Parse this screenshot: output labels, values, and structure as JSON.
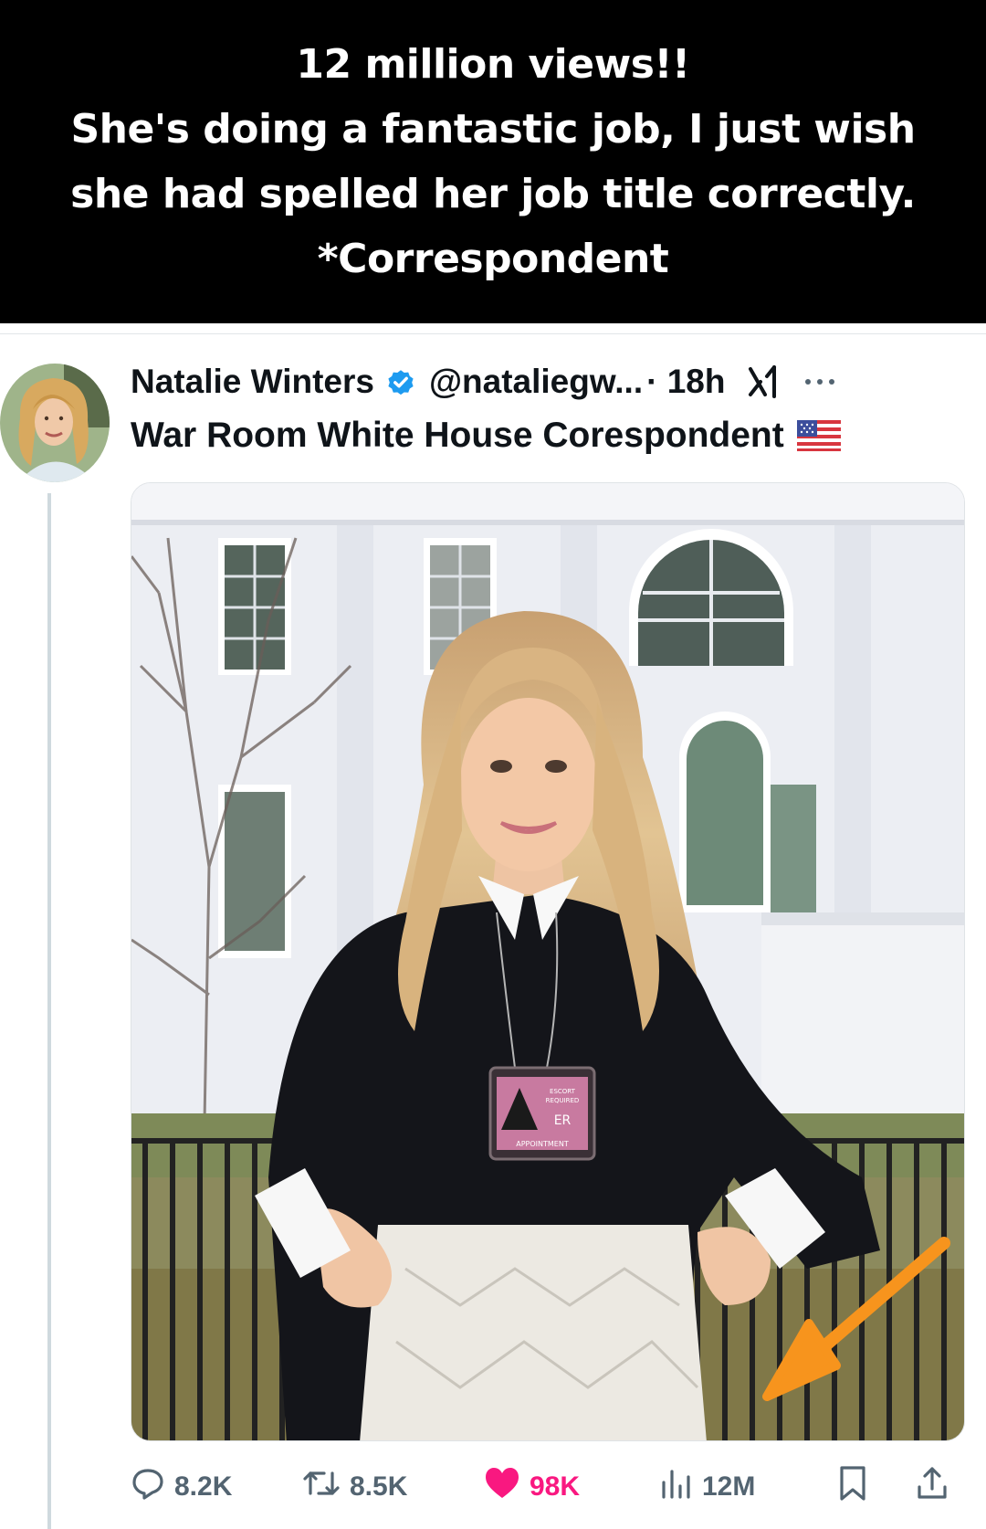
{
  "caption": {
    "lines": [
      "12 million views!!",
      "She's doing a fantastic job, I just wish",
      "she had spelled her job title correctly.",
      "*Correspondent"
    ]
  },
  "tweet": {
    "author_name": "Natalie Winters",
    "handle": "@nataliegw...",
    "time": "· 18h",
    "bio": "War Room White House Corespondent",
    "badge_text": {
      "line1": "ESCORT",
      "line2": "REQUIRED",
      "letters": "ER",
      "bottom": "APPOINTMENT"
    },
    "stats": {
      "replies": "8.2K",
      "reposts": "8.5K",
      "likes": "98K",
      "views": "12M"
    }
  },
  "colors": {
    "verified": "#1d9bf0",
    "like": "#f91880",
    "annotation_arrow": "#f7941d"
  },
  "icons": [
    "verified-icon",
    "grok-icon",
    "more-icon",
    "flag-icon",
    "reply-icon",
    "retweet-icon",
    "like-icon",
    "views-icon",
    "bookmark-icon",
    "share-icon"
  ]
}
